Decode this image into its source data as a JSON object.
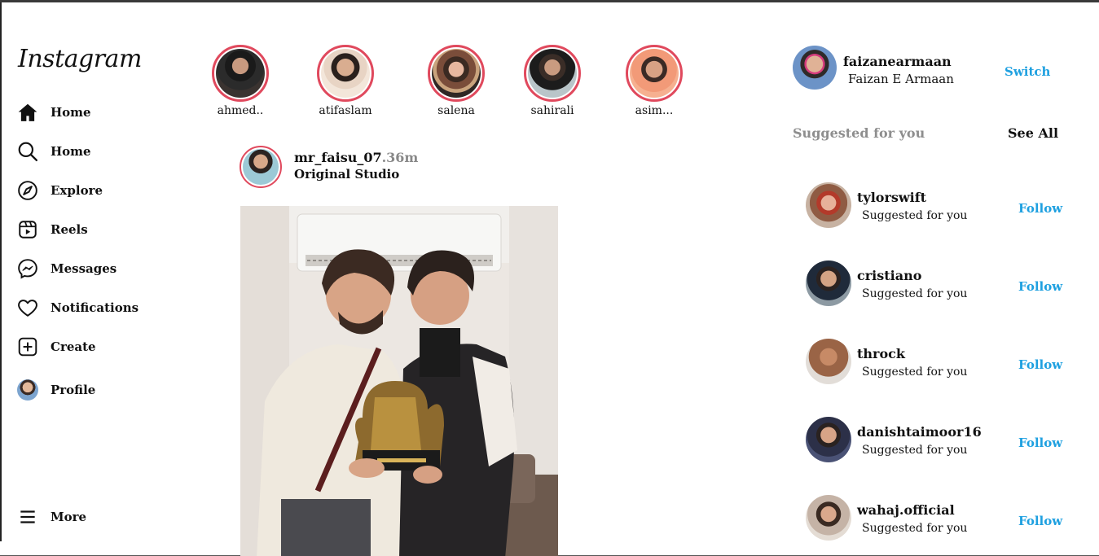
{
  "brand": {
    "logo_text": "Instagram"
  },
  "sidebar": {
    "items": [
      {
        "label": "Home",
        "icon": "home-icon"
      },
      {
        "label": "Home",
        "icon": "search-icon"
      },
      {
        "label": "Explore",
        "icon": "compass-icon"
      },
      {
        "label": "Reels",
        "icon": "reels-icon"
      },
      {
        "label": "Messages",
        "icon": "messenger-icon"
      },
      {
        "label": "Notifications",
        "icon": "heart-icon"
      },
      {
        "label": "Create",
        "icon": "plus-square-icon"
      },
      {
        "label": "Profile",
        "icon": "avatar"
      },
      {
        "label": "More",
        "icon": "menu-icon"
      }
    ]
  },
  "stories": [
    {
      "name": "ahmed.."
    },
    {
      "name": "atifaslam"
    },
    {
      "name": "salena"
    },
    {
      "name": "sahirali"
    },
    {
      "name": "asim..."
    }
  ],
  "post": {
    "username": "mr_faisu_07",
    "time": ".36m",
    "subtitle": "Original Studio"
  },
  "account": {
    "username": "faizanearmaan",
    "full_name": "Faizan E Armaan",
    "switch_label": "Switch"
  },
  "suggestions": {
    "title": "Suggested for you",
    "see_all": "See All",
    "items": [
      {
        "username": "tylorswift",
        "subtitle": "Suggested for you",
        "action": "Follow"
      },
      {
        "username": "cristiano",
        "subtitle": "Suggested for you",
        "action": "Follow"
      },
      {
        "username": "throck",
        "subtitle": "Suggested for you",
        "action": "Follow"
      },
      {
        "username": "danishtaimoor16",
        "subtitle": "Suggested for you",
        "action": "Follow"
      },
      {
        "username": "wahaj.official",
        "subtitle": "Suggested for you",
        "action": "Follow"
      }
    ]
  },
  "colors": {
    "story_ring": "#e0495d",
    "link_blue": "#1ea0e0",
    "muted_gray": "#8e8e8e"
  }
}
